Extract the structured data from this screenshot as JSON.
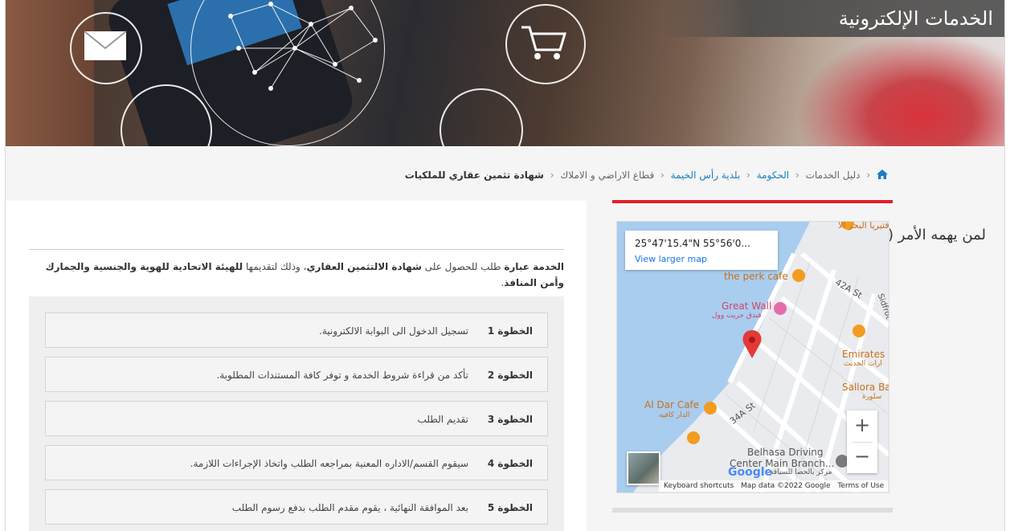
{
  "banner": {
    "title": "الخدمات الإلكترونية"
  },
  "breadcrumb": {
    "items": [
      "دليل الخدمات",
      "الحكومة",
      "بلدية رأس الخيمة",
      "قطاع الاراضي و الاملاك"
    ],
    "current": "شهادة تثمين عقاري للملكيات",
    "separator": "‹"
  },
  "service": {
    "title": "لمن يهمه الأمر ( شهادة تثمين عقاري)",
    "desc_part1": "الخدمة عبارة",
    "desc_part2": " طلب للحصول على ",
    "desc_bold1": "شهادة الالتثمين العقاري",
    "desc_part3": "، وذلك لتقديمها ",
    "desc_bold2": "للهيئة الاتحادية للهوية والجنسية والجمارك وأمن المنافذ",
    "desc_end": "."
  },
  "steps": [
    {
      "label": "الخطوة 1",
      "text": "تسجيل الدخول الى البوابة الالكترونية."
    },
    {
      "label": "الخطوة 2",
      "text": "تأكد من قراءة شروط الخدمة و توفر كافة المستندات المطلوبة."
    },
    {
      "label": "الخطوة 3",
      "text": "تقديم الطلب"
    },
    {
      "label": "الخطوة 4",
      "text": "سيقوم القسم/الاداره المعنية بمراجعه الطلب واتخاذ الإجراءات اللازمة."
    },
    {
      "label": "الخطوة 5",
      "text": "بعد الموافقة النهائية ، يقوم مقدم الطلب بدفع رسوم الطلب"
    }
  ],
  "map": {
    "coords": "25°47'15.4\"N 55°56'0...",
    "view_larger": "View larger map",
    "zoom_in": "+",
    "zoom_out": "−",
    "google": "Google",
    "attribution": [
      "Keyboard shortcuts",
      "Map data ©2022 Google",
      "Terms of Use"
    ],
    "labels": {
      "cafeteria": "كافتيريا البحر الا...",
      "perk": "the perk cafe",
      "st42a": "42A St",
      "great_wall": "Great Wall",
      "great_wall_ar": "فندق جريت وول",
      "emirates": "Emirates",
      "emirates_ar": "ارات الحديث",
      "sallora": "Sallora Ba",
      "sallora_ar": "سلورة",
      "aldar": "Al Dar Cafe",
      "aldar_ar": "الدار كافيه",
      "st34a": "34A St",
      "belhasa": "Belhasa Driving",
      "belhasa2": "Center Main Branch...",
      "belhasa_ar": "مركز بالحصا للسياقة",
      "sidfrom": "Sidfrot"
    }
  },
  "colors": {
    "accent_red": "#e31e24",
    "link_blue": "#1a7fc1",
    "map_blue": "#1a73e8",
    "marker_red": "#e53935"
  }
}
